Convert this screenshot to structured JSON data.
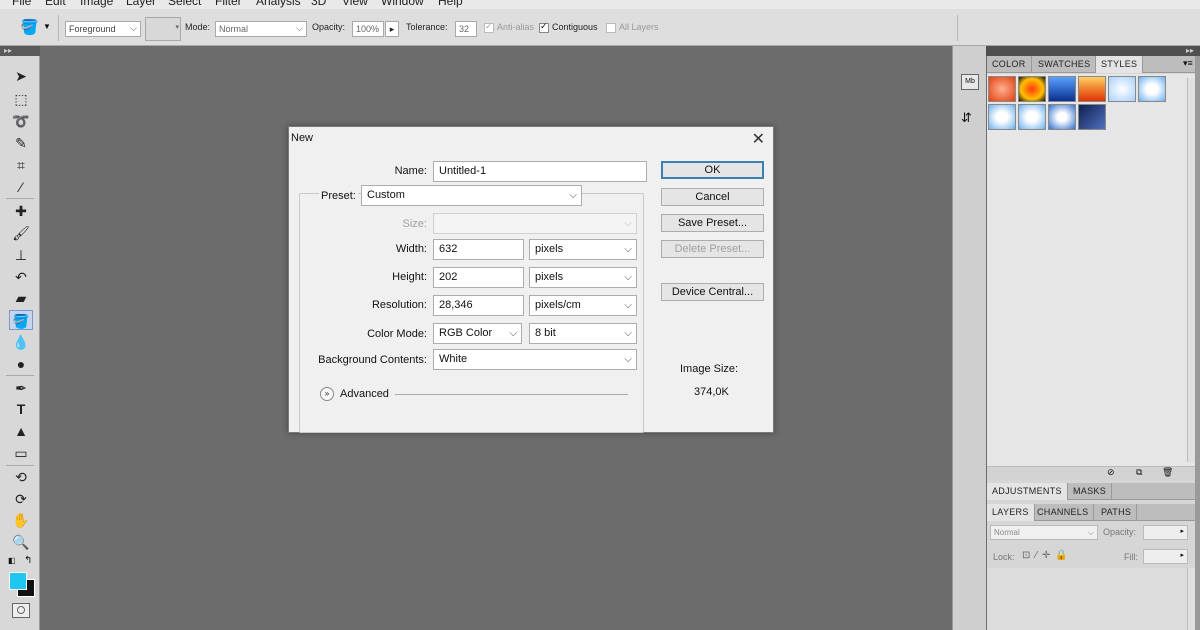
{
  "menu": [
    "File",
    "Edit",
    "Image",
    "Layer",
    "Select",
    "Filter",
    "Analysis",
    "3D",
    "View",
    "Window",
    "Help"
  ],
  "options_bar": {
    "fill_source": "Foreground",
    "mode_label": "Mode:",
    "mode_value": "Normal",
    "opacity_label": "Opacity:",
    "opacity_value": "100%",
    "tolerance_label": "Tolerance:",
    "tolerance_value": "32",
    "anti_alias_label": "Anti-alias",
    "anti_alias_checked": true,
    "contiguous_label": "Contiguous",
    "contiguous_checked": true,
    "all_layers_label": "All Layers",
    "all_layers_checked": false
  },
  "tools": [
    "move-icon",
    "marquee-icon",
    "lasso-icon",
    "quick-select-icon",
    "crop-icon",
    "eyedropper-icon",
    "healing-brush-icon",
    "brush-icon",
    "clone-stamp-icon",
    "history-brush-icon",
    "eraser-icon",
    "paint-bucket-icon",
    "blur-icon",
    "dodge-icon",
    "pen-icon",
    "type-icon",
    "path-select-icon",
    "rectangle-icon",
    "3d-rotate-icon",
    "3d-orbit-icon",
    "hand-icon",
    "zoom-icon"
  ],
  "colors": {
    "foreground": "#1ec6f0",
    "background": "#111111",
    "accent": "#3c7fb1"
  },
  "panels": {
    "top_tabs": [
      "COLOR",
      "SWATCHES",
      "STYLES"
    ],
    "adjust_tabs": [
      "ADJUSTMENTS",
      "MASKS"
    ],
    "layer_tabs": [
      "LAYERS",
      "CHANNELS",
      "PATHS"
    ],
    "blend_mode": "Normal",
    "opacity_label": "Opacity:",
    "lock_label": "Lock:",
    "fill_label": "Fill:"
  },
  "dialog": {
    "title": "New",
    "name_label": "Name:",
    "name_value": "Untitled-1",
    "preset_label": "Preset:",
    "preset_value": "Custom",
    "size_label": "Size:",
    "width_label": "Width:",
    "width_value": "632",
    "width_unit": "pixels",
    "height_label": "Height:",
    "height_value": "202",
    "height_unit": "pixels",
    "resolution_label": "Resolution:",
    "resolution_value": "28,346",
    "resolution_unit": "pixels/cm",
    "color_mode_label": "Color Mode:",
    "color_mode_value": "RGB Color",
    "bit_depth_value": "8 bit",
    "bg_contents_label": "Background Contents:",
    "bg_contents_value": "White",
    "advanced_label": "Advanced",
    "ok_label": "OK",
    "cancel_label": "Cancel",
    "save_preset_label": "Save Preset...",
    "delete_preset_label": "Delete Preset...",
    "device_central_label": "Device Central...",
    "image_size_label": "Image Size:",
    "image_size_value": "374,0K"
  }
}
